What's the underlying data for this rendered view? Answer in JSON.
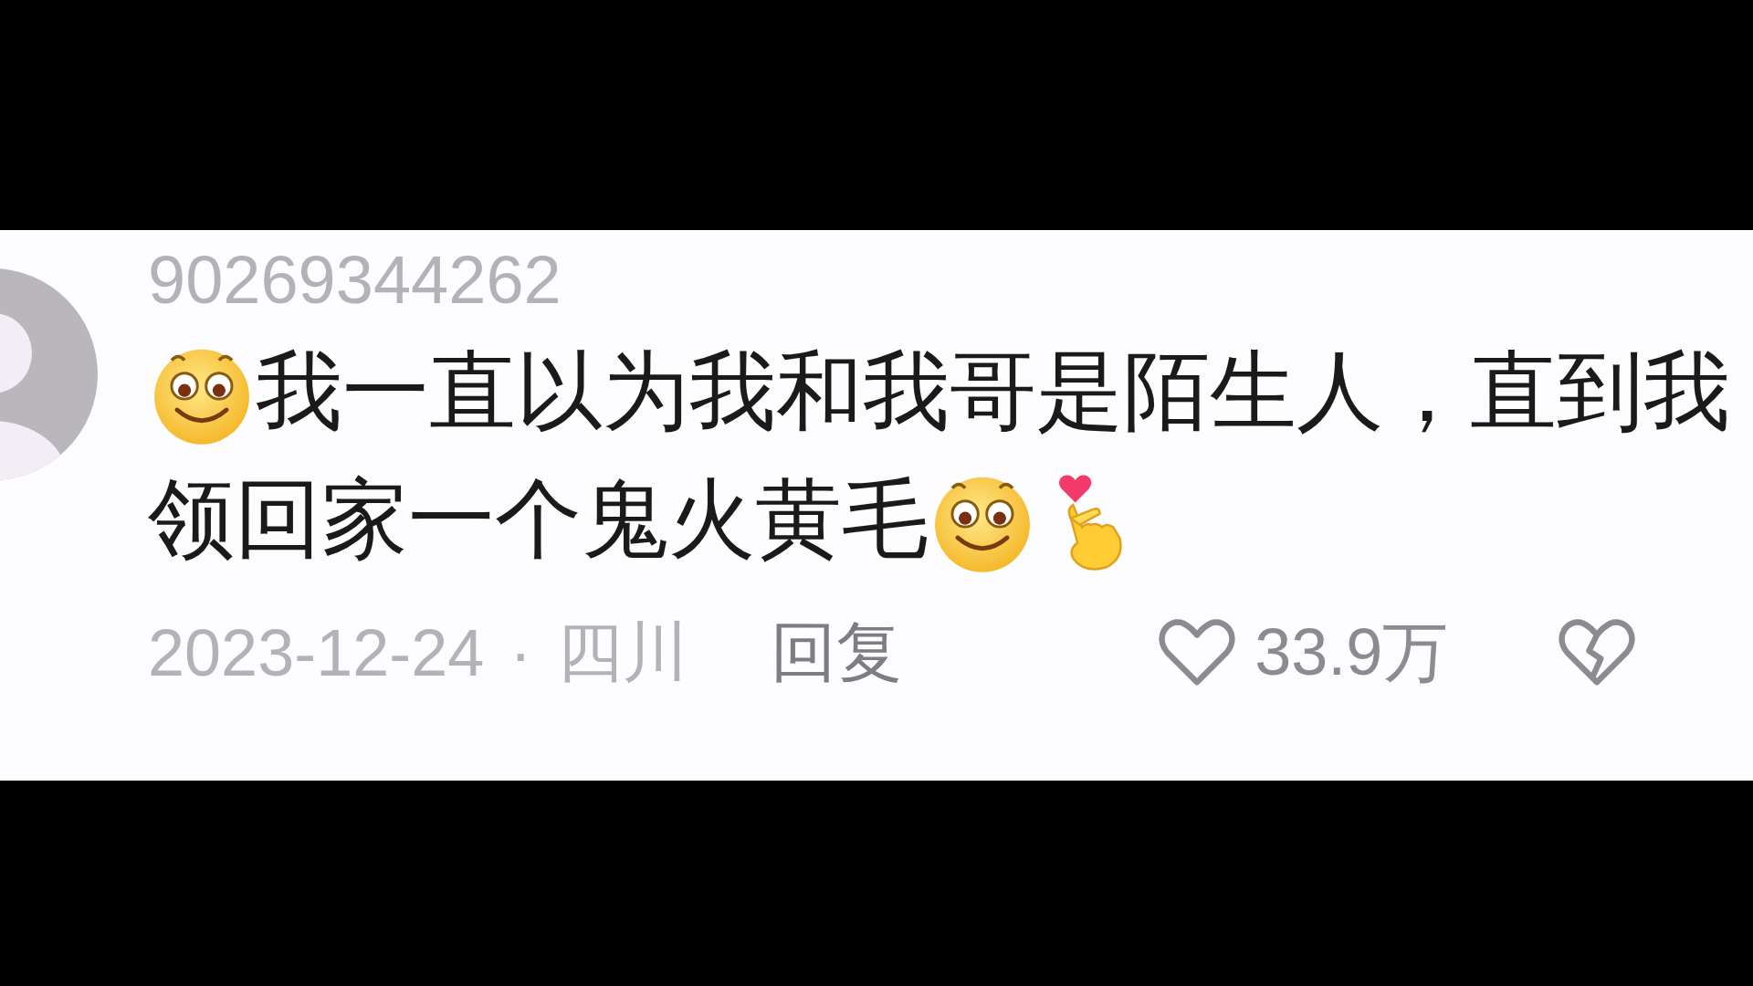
{
  "comment": {
    "username": "90269344262",
    "lines": [
      [
        {
          "kind": "smile"
        },
        {
          "kind": "text",
          "text": "我一直以为我和我哥是陌生人，直到我"
        }
      ],
      [
        {
          "kind": "text",
          "text": "领回家一个鬼火黄毛"
        },
        {
          "kind": "smile"
        },
        {
          "kind": "finger_heart"
        }
      ]
    ],
    "date": "2023-12-24",
    "separator": "·",
    "location": "四川",
    "reply": "回复",
    "likes": "33.9万"
  }
}
